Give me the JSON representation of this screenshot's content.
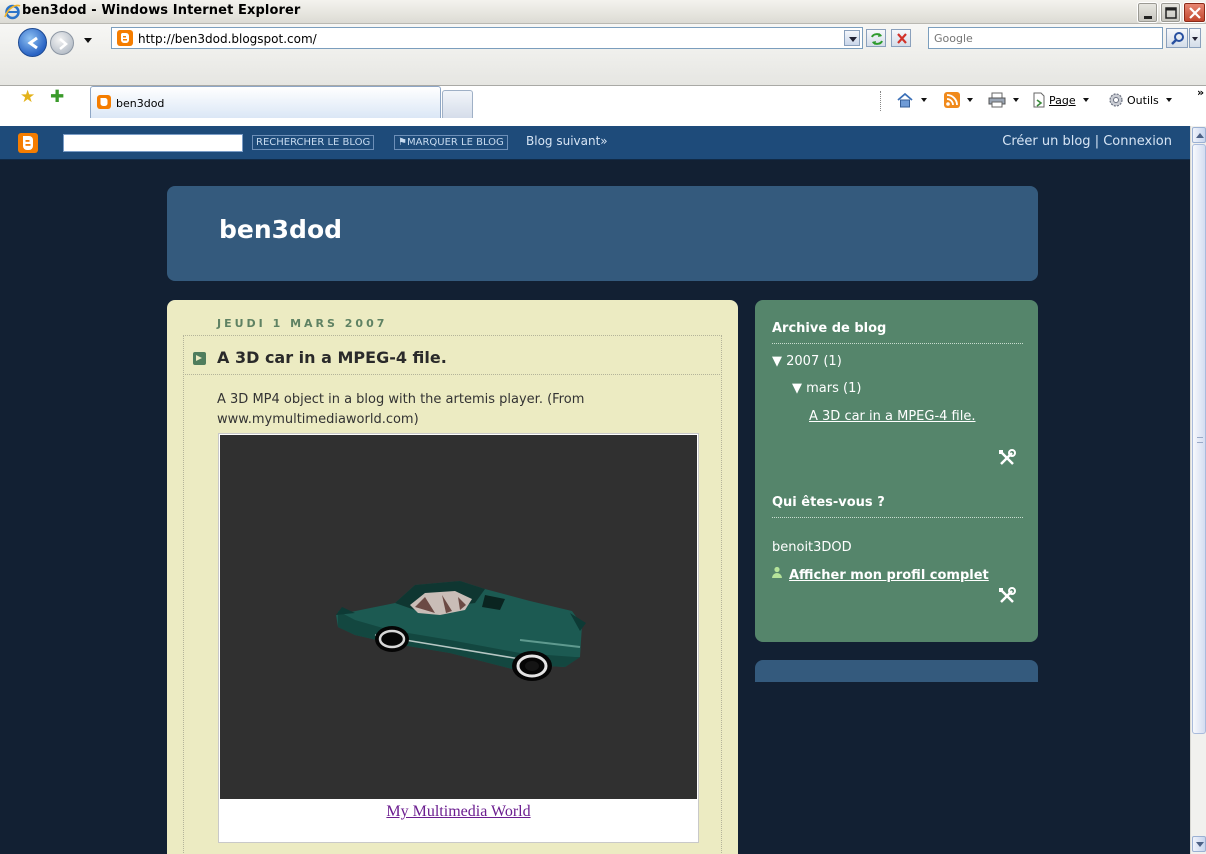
{
  "window": {
    "title": "ben3dod - Windows Internet Explorer"
  },
  "address_bar": {
    "url": "http://ben3dod.blogspot.com/"
  },
  "search": {
    "placeholder": "Google"
  },
  "tab": {
    "label": "ben3dod"
  },
  "command_bar": {
    "page_label": "Page",
    "tools_label": "Outils",
    "overflow": "»"
  },
  "blogger_navbar": {
    "search_button": "RECHERCHER LE BLOG",
    "flag_button": "MARQUER LE BLOG",
    "next_blog": "Blog suivant»",
    "create_blog": "Créer un blog",
    "separator": "|",
    "login": "Connexion"
  },
  "blog": {
    "title": "ben3dod"
  },
  "post": {
    "date": "JEUDI 1 MARS 2007",
    "title": "A 3D car in a MPEG-4 file.",
    "body": "A 3D MP4 object in a blog with the artemis player. (From www.mymultimediaworld.com)",
    "media_link": "My Multimedia World"
  },
  "sidebar": {
    "archive_title": "Archive de blog",
    "archive_year": "▼ 2007 (1)",
    "archive_month": "▼ mars (1)",
    "archive_post": "A 3D car in a MPEG-4 file.",
    "profile_title": "Qui êtes-vous ?",
    "profile_name": "benoit3DOD",
    "profile_link": "Afficher mon profil complet"
  },
  "colors": {
    "blogger_bar": "#1e4b7a",
    "page_background": "#122033",
    "header_box": "#345a7d",
    "post_column": "#ecebc2",
    "sidebar": "#55856b",
    "date_text": "#5f8263",
    "visited_link": "#6b1d8f"
  }
}
